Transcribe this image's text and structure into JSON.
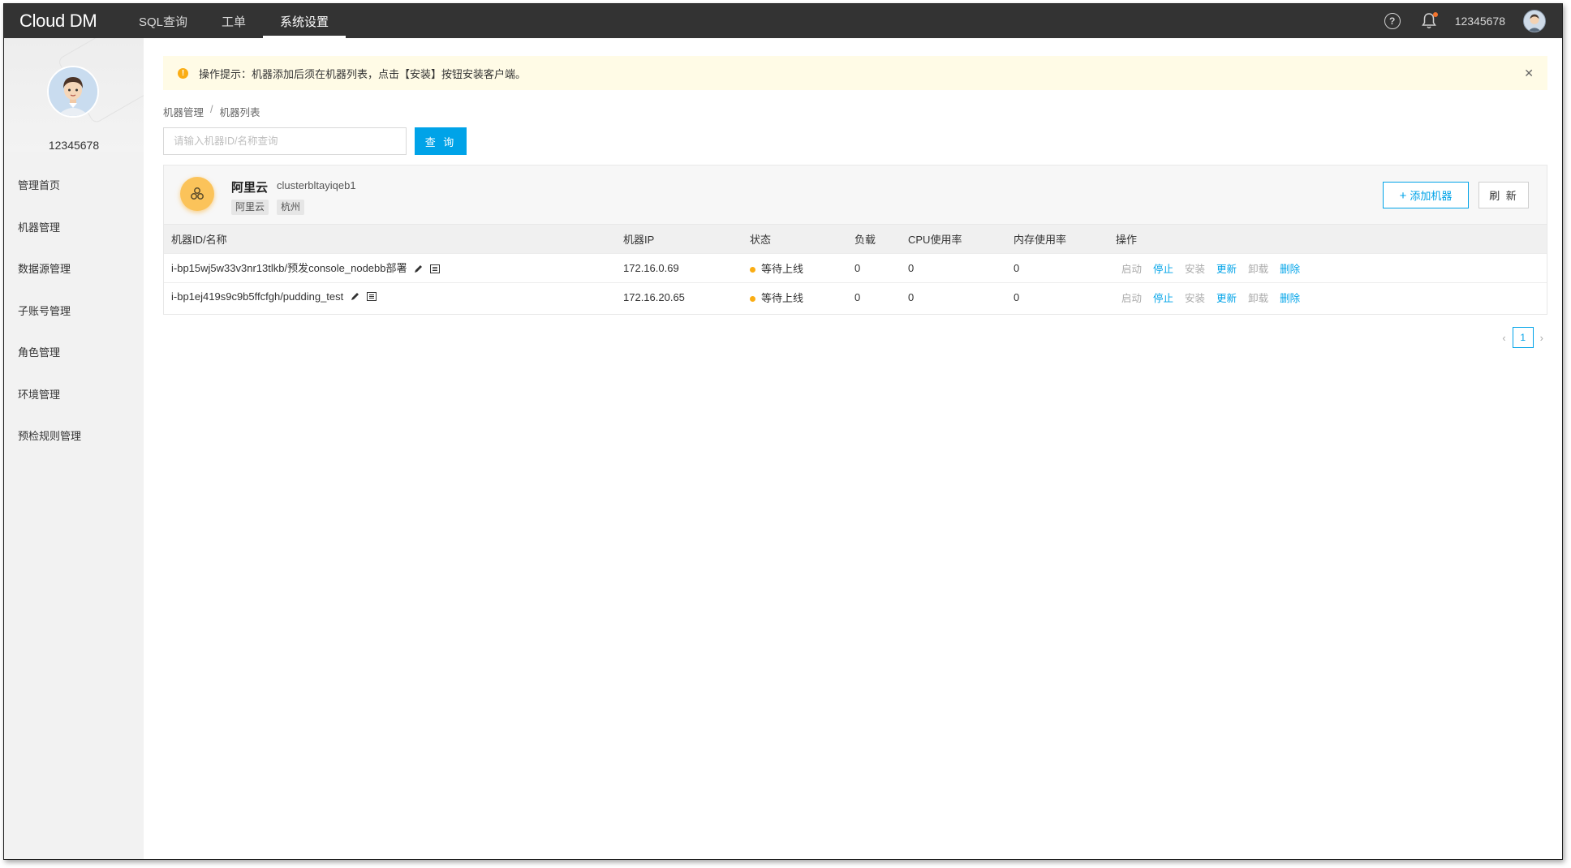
{
  "topbar": {
    "logo": "Cloud DM",
    "nav": [
      {
        "label": "SQL查询"
      },
      {
        "label": "工单"
      },
      {
        "label": "系统设置"
      }
    ],
    "username": "12345678"
  },
  "sidebar": {
    "username": "12345678",
    "items": [
      {
        "label": "管理首页"
      },
      {
        "label": "机器管理"
      },
      {
        "label": "数据源管理"
      },
      {
        "label": "子账号管理"
      },
      {
        "label": "角色管理"
      },
      {
        "label": "环境管理"
      },
      {
        "label": "预检规则管理"
      }
    ]
  },
  "alert": {
    "text": "操作提示：机器添加后须在机器列表，点击【安装】按钮安装客户端。"
  },
  "breadcrumb": {
    "parent": "机器管理",
    "separator": "/",
    "current": "机器列表"
  },
  "search": {
    "placeholder": "请输入机器ID/名称查询",
    "button": "查 询"
  },
  "cluster": {
    "name": "阿里云",
    "id": "clusterbltayiqeb1",
    "tags": [
      "阿里云",
      "杭州"
    ],
    "add_button": "添加机器",
    "refresh_button": "刷 新"
  },
  "table": {
    "headers": [
      "机器ID/名称",
      "机器IP",
      "状态",
      "负载",
      "CPU使用率",
      "内存使用率",
      "操作"
    ],
    "rows": [
      {
        "name": "i-bp15wj5w33v3nr13tlkb/预发console_nodebb部署",
        "ip": "172.16.0.69",
        "status": "等待上线",
        "load": "0",
        "cpu": "0",
        "mem": "0"
      },
      {
        "name": "i-bp1ej419s9c9b5ffcfgh/pudding_test",
        "ip": "172.16.20.65",
        "status": "等待上线",
        "load": "0",
        "cpu": "0",
        "mem": "0"
      }
    ],
    "actions": [
      "启动",
      "停止",
      "安装",
      "更新",
      "卸载",
      "删除"
    ]
  },
  "pagination": {
    "current": "1"
  },
  "colors": {
    "accent": "#00a3e8",
    "topbar": "#333333",
    "status_pending": "#faad14",
    "alert_bg": "#fffbe6"
  }
}
